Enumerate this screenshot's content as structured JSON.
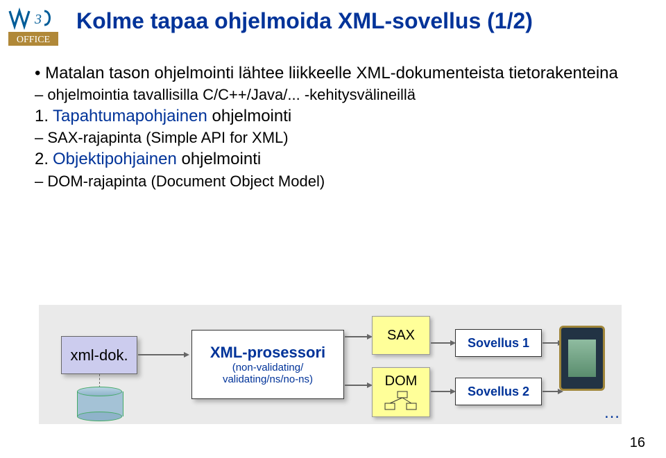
{
  "logo": {
    "top_text": "W3C",
    "bottom_text": "OFFICE"
  },
  "title": "Kolme tapaa ohjelmoida XML-sovellus (1/2)",
  "level1": "Matalan tason ohjelmointi lähtee liikkeelle XML-dokumenteista tietorakenteina",
  "sub1": "ohjelmointia tavallisilla C/C++/Java/... -kehitysvälineillä",
  "item1_num": "1.",
  "item1_term": "Tapahtumapohjainen",
  "item1_rest": " ohjelmointi",
  "item1_sub": "SAX-rajapinta (Simple API for XML)",
  "item2_num": "2.",
  "item2_term": "Objektipohjainen",
  "item2_rest": " ohjelmointi",
  "item2_sub": "DOM-rajapinta (Document Object Model)",
  "diagram": {
    "xml_doc": "xml-dok.",
    "proc_title": "XML-prosessori",
    "proc_sub1": "(non-validating/",
    "proc_sub2": "validating/ns/no-ns)",
    "sax": "SAX",
    "dom": "DOM",
    "sov1": "Sovellus 1",
    "sov2": "Sovellus 2",
    "ellipsis": "…"
  },
  "page_number": "16"
}
